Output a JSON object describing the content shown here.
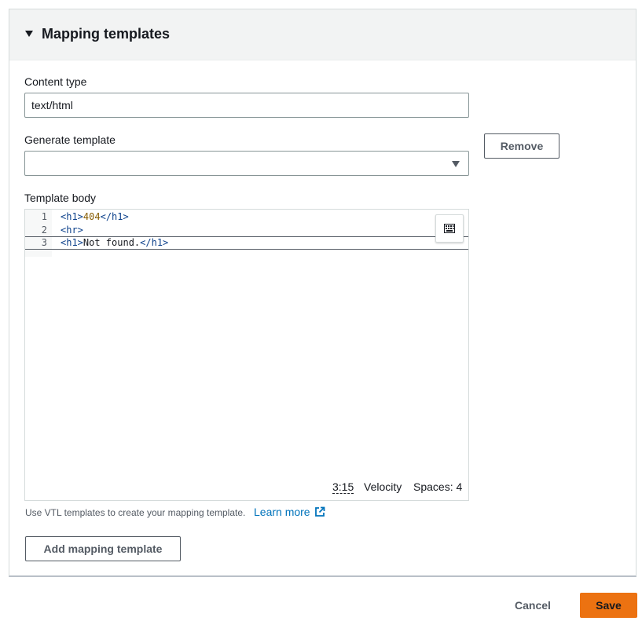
{
  "section": {
    "title": "Mapping templates",
    "content_type_label": "Content type",
    "content_type_value": "text/html",
    "generate_template_label": "Generate template",
    "generate_template_value": "",
    "remove_label": "Remove",
    "template_body_label": "Template body",
    "editor": {
      "lines": [
        {
          "number": "1",
          "open_tag": "<h1>",
          "text": "404",
          "close_tag": "</h1>"
        },
        {
          "number": "2",
          "open_tag": "<hr>",
          "text": "",
          "close_tag": ""
        },
        {
          "number": "3",
          "open_tag": "<h1>",
          "text": "Not found.",
          "close_tag": "</h1>"
        }
      ],
      "cursor_position": "3:15",
      "language": "Velocity",
      "spaces": "Spaces: 4",
      "keyboard_icon": "keyboard-icon"
    },
    "help_text": "Use VTL templates to create your mapping template.",
    "learn_more": "Learn more",
    "add_button": "Add mapping template"
  },
  "footer": {
    "cancel": "Cancel",
    "save": "Save"
  },
  "colors": {
    "accent": "#ec7211",
    "link": "#0073bb",
    "tag": "#0a3f8a",
    "number": "#875c00"
  }
}
